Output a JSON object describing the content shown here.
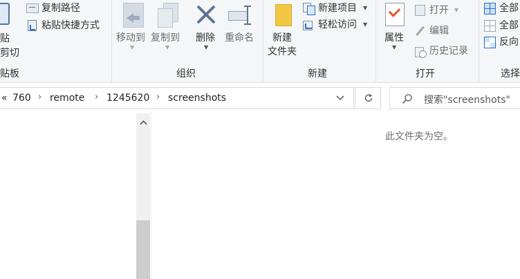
{
  "ribbon": {
    "clipboard": {
      "paste_label": "贴",
      "cut_label": "剪切",
      "copy_path_label": "复制路径",
      "paste_shortcut_label": "粘贴快捷方式",
      "group_label": "贴板"
    },
    "organize": {
      "move_to_label": "移动到",
      "copy_to_label": "复制到",
      "delete_label": "删除",
      "rename_label": "重命名",
      "group_label": "组织"
    },
    "new": {
      "new_folder_line1": "新建",
      "new_folder_line2": "文件夹",
      "new_item_label": "新建项目",
      "easy_access_label": "轻松访问",
      "group_label": "新建"
    },
    "open": {
      "properties_label": "属性",
      "open_label": "打开",
      "edit_label": "编辑",
      "history_label": "历史记录",
      "group_label": "打开"
    },
    "select": {
      "select_all_label": "全部",
      "select_none_label": "全部",
      "invert_label": "反向",
      "group_label": "选择"
    }
  },
  "address_bar": {
    "overflow": "«",
    "segments": [
      "760",
      "remote",
      "1245620",
      "screenshots"
    ]
  },
  "search": {
    "placeholder": "搜索\"screenshots\""
  },
  "content": {
    "empty_message": "此文件夹为空。"
  }
}
